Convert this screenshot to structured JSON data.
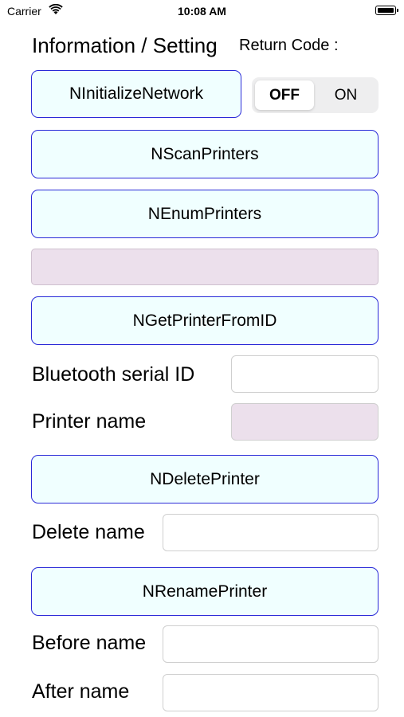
{
  "status_bar": {
    "carrier": "Carrier",
    "time": "10:08 AM"
  },
  "header": {
    "title": "Information / Setting",
    "return_code_label": "Return Code :"
  },
  "buttons": {
    "initialize_network": "NInitializeNetwork",
    "scan_printers": "NScanPrinters",
    "enum_printers": "NEnumPrinters",
    "get_printer_from_id": "NGetPrinterFromID",
    "delete_printer": "NDeletePrinter",
    "rename_printer": "NRenamePrinter"
  },
  "toggle": {
    "off_label": "OFF",
    "on_label": "ON",
    "selected": "OFF"
  },
  "fields": {
    "bluetooth_serial_id": {
      "label": "Bluetooth serial ID",
      "value": ""
    },
    "printer_name": {
      "label": "Printer name",
      "value": ""
    },
    "delete_name": {
      "label": "Delete name",
      "value": ""
    },
    "before_name": {
      "label": "Before name",
      "value": ""
    },
    "after_name": {
      "label": "After name",
      "value": ""
    }
  },
  "colors": {
    "button_bg": "#f0ffff",
    "button_border": "#2a2ad8",
    "readonly_bg": "#ece0ec"
  },
  "icons": {
    "wifi": "wifi-icon",
    "battery": "battery-icon"
  }
}
